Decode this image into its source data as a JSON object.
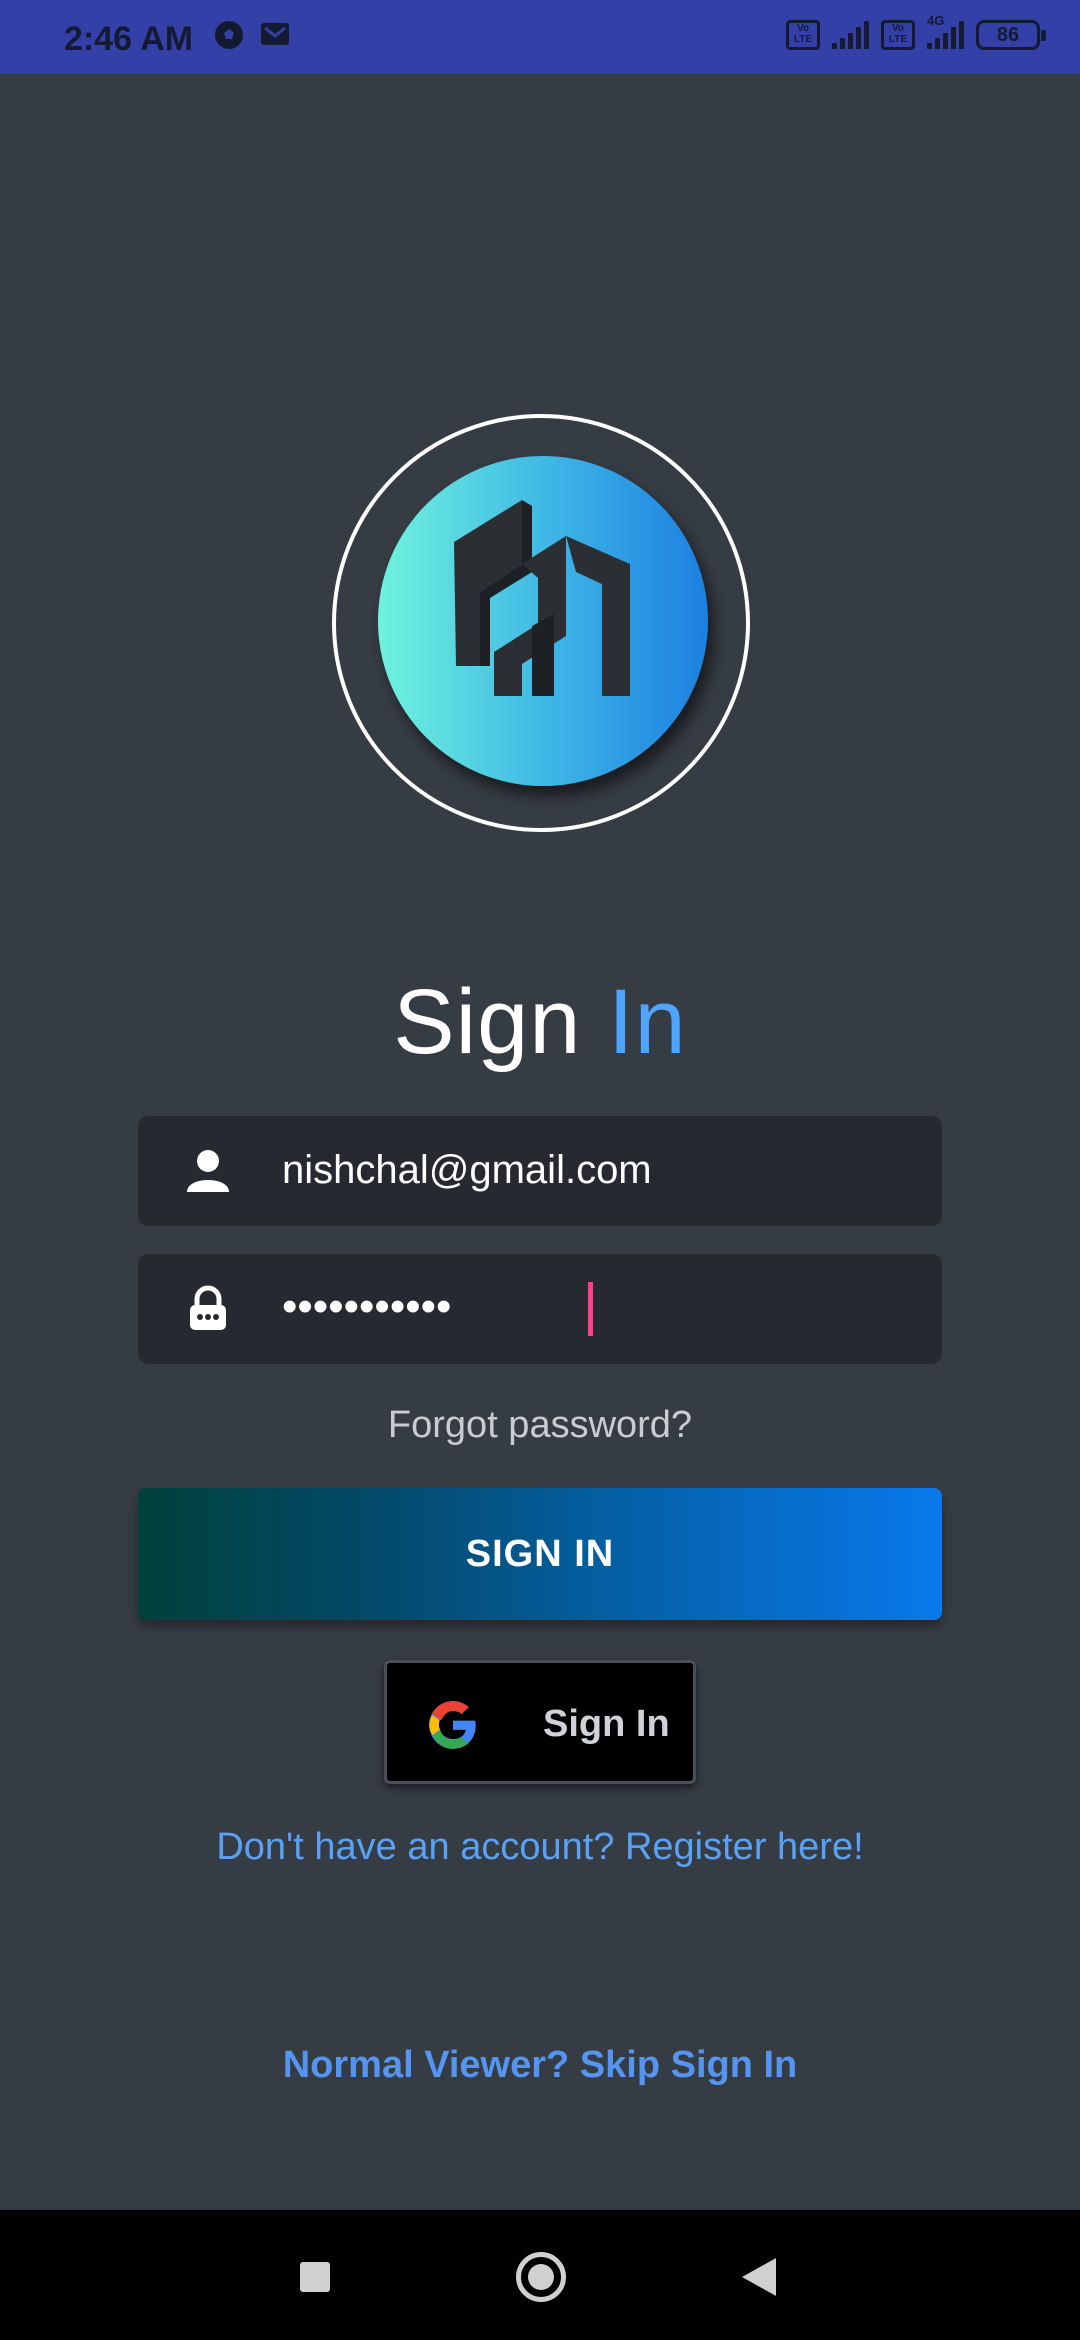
{
  "status_bar": {
    "time": "2:46 AM",
    "left_icons": [
      "soccer-ball-icon",
      "gmail-icon"
    ],
    "volte_label": "Vo LTE",
    "network_label": "4G",
    "battery": "86"
  },
  "logo": {
    "name": "app-logo",
    "gradient": [
      "#6ff3dd",
      "#1c7fe0"
    ]
  },
  "title": {
    "word1": "Sign",
    "word2": "In"
  },
  "form": {
    "email_value": "nishchal@gmail.com",
    "password_masked": "•••••••••••",
    "forgot_label": "Forgot password?",
    "signin_label": "SIGN IN",
    "google_label": "Sign In",
    "register_label": "Don't have an account? Register here!",
    "skip_label": "Normal Viewer? Skip Sign In"
  },
  "colors": {
    "background": "#363c44",
    "status_bar": "#3340a8",
    "accent_blue": "#4ea4ff",
    "field_bg": "#262a30",
    "cursor": "#ff3f8b"
  },
  "nav_bar": {
    "icons": [
      "recents-square-icon",
      "home-circle-icon",
      "back-triangle-icon"
    ]
  }
}
